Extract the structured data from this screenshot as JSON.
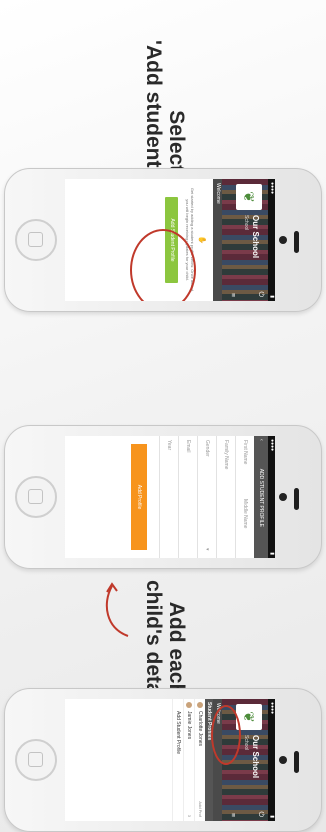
{
  "steps": [
    {
      "caption_line1": "Select",
      "caption_line2": "'Add student profile'"
    },
    {
      "caption_line1": "Add each",
      "caption_line2": "child's details"
    }
  ],
  "app": {
    "school_name": "Our School",
    "school_sub": "School",
    "welcome": "Welcome",
    "intro_text": "Get started by adding a student profile below. Once added, you will begin receiving updates for your child.",
    "add_student_button": "Add Student Profile"
  },
  "form": {
    "nav_title": "ADD STUDENT PROFILE",
    "fields": [
      {
        "label": "First Name",
        "secondary": "Middle Name"
      },
      {
        "label": "Family Name",
        "secondary": ""
      },
      {
        "label": "Gender",
        "secondary": ""
      },
      {
        "label": "Email",
        "secondary": ""
      },
      {
        "label": "Year",
        "secondary": ""
      }
    ],
    "submit_button": "Add Profile"
  },
  "menu": {
    "welcome": "Welcome",
    "section_title": "Student Profiles",
    "students": [
      {
        "name": "Charlotte Jones",
        "note": "Add Prof"
      },
      {
        "name": "Jamie Jones",
        "note": "3"
      }
    ],
    "add_link": "Add Student Profile"
  },
  "colors": {
    "accent_green": "#8cc63f",
    "accent_orange": "#f7941d",
    "annotation_red": "#c0392b"
  }
}
